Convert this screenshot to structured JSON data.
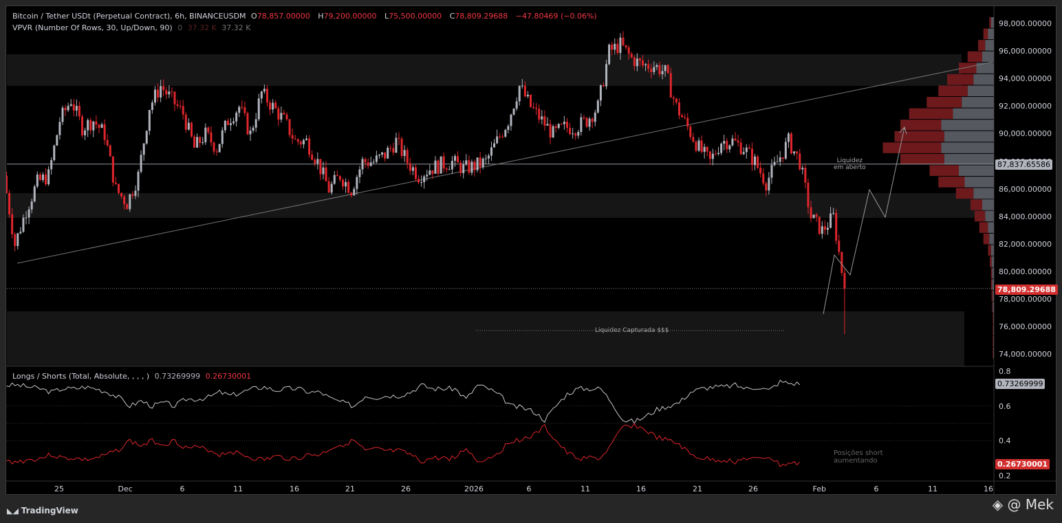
{
  "legend": {
    "symbol": "Bitcoin / Tether USDt (Perpetual Contract), 6h, BINANCEUSDM",
    "o_label": "O",
    "o": "78,857.00000",
    "h_label": "H",
    "h": "79,200.00000",
    "l_label": "L",
    "l": "75,500.00000",
    "c_label": "C",
    "c": "78,809.29688",
    "change": "−47.80469 (−0.06%)",
    "vpvr": "VPVR (Number Of Rows, 30, Up/Down, 90)",
    "vpvr_v0": "0",
    "vpvr_v1": "37.32 K",
    "vpvr_v2": "37.32 K"
  },
  "indicator": {
    "title": "Longs / Shorts (Total, Absolute, , , , )",
    "longs": "0.73269999",
    "shorts": "0.26730001"
  },
  "annotations": {
    "liq_open_1": "Liquidez",
    "liq_open_2": "em aberto",
    "liq_captured": "Liquidez Capturada $$$",
    "short_1": "Posições short",
    "short_2": "aumentando"
  },
  "price_axis": [
    "98,000.00000",
    "96,000.00000",
    "94,000.00000",
    "92,000.00000",
    "90,000.00000",
    "88,000.00000",
    "86,000.00000",
    "84,000.00000",
    "82,000.00000",
    "80,000.00000",
    "78,000.00000",
    "76,000.00000",
    "74,000.00000"
  ],
  "price_tags": {
    "level": "87,837.65586",
    "last": "78,809.29688"
  },
  "ind_axis": [
    "0.8",
    "0.6",
    "0.4",
    "0.2"
  ],
  "time_axis": [
    "25",
    "Dec",
    "6",
    "11",
    "16",
    "21",
    "26",
    "2026",
    "6",
    "11",
    "16",
    "21",
    "26",
    "Feb",
    "6",
    "11",
    "16"
  ],
  "footer": {
    "brand": "TradingView",
    "watermark": "@ Mek"
  },
  "colors": {
    "up": "#b2b5be",
    "down": "#e0262c",
    "tag_red": "#d32f2f"
  },
  "chart_data": {
    "type": "candlestick",
    "price_waypoints_by_day": [
      87000,
      82000,
      84500,
      86500,
      87000,
      91000,
      92500,
      90500,
      91000,
      90000,
      86000,
      85000,
      87000,
      92000,
      93500,
      92500,
      91500,
      89000,
      90000,
      89000,
      91000,
      92000,
      90000,
      93000,
      92000,
      91000,
      89500,
      89500,
      88000,
      86000,
      87000,
      86000,
      88000,
      88000,
      88500,
      89500,
      88000,
      87000,
      87500,
      87800,
      88000,
      87500,
      87700,
      88000,
      89500,
      91000,
      93500,
      92000,
      91000,
      90000,
      90500,
      90500,
      91000,
      92000,
      96000,
      96500,
      95500,
      95000,
      95000,
      94500,
      92000,
      90500,
      89000,
      88000,
      89500,
      89500,
      89000,
      88000,
      86500,
      88000,
      89500,
      88000,
      84000,
      83000,
      84000,
      78800
    ],
    "longs_by_day": [
      0.72,
      0.72,
      0.71,
      0.7,
      0.68,
      0.7,
      0.7,
      0.71,
      0.7,
      0.68,
      0.65,
      0.6,
      0.63,
      0.6,
      0.62,
      0.6,
      0.64,
      0.64,
      0.65,
      0.68,
      0.66,
      0.68,
      0.7,
      0.71,
      0.69,
      0.7,
      0.7,
      0.68,
      0.68,
      0.64,
      0.62,
      0.6,
      0.66,
      0.65,
      0.66,
      0.66,
      0.68,
      0.72,
      0.7,
      0.7,
      0.7,
      0.64,
      0.72,
      0.7,
      0.66,
      0.6,
      0.59,
      0.57,
      0.52,
      0.6,
      0.67,
      0.7,
      0.7,
      0.7,
      0.62,
      0.52,
      0.51,
      0.54,
      0.58,
      0.6,
      0.62,
      0.68,
      0.7,
      0.71,
      0.71,
      0.72,
      0.7,
      0.71,
      0.69,
      0.74,
      0.73,
      0.73
    ],
    "vpvr_up": [
      0.05,
      0.1,
      0.15,
      0.2,
      0.3,
      0.35,
      0.45,
      0.55,
      0.7,
      0.9,
      0.85,
      0.9,
      0.85,
      0.6,
      0.5,
      0.35,
      0.2,
      0.15,
      0.1,
      0.08,
      0.05,
      0.04,
      0.03,
      0.03,
      0.02,
      0.02,
      0.01,
      0.01,
      0.01,
      0.01
    ],
    "vpvr_down": [
      0.03,
      0.08,
      0.12,
      0.25,
      0.3,
      0.45,
      0.5,
      0.6,
      0.75,
      0.7,
      0.85,
      1.0,
      0.75,
      0.5,
      0.45,
      0.3,
      0.2,
      0.18,
      0.15,
      0.1,
      0.05,
      0.03,
      0.02,
      0.02,
      0.02,
      0.01,
      0.01,
      0.01,
      0.01,
      0.01
    ],
    "last_low": 75500,
    "level": 87837.66,
    "last": 78809.3
  }
}
